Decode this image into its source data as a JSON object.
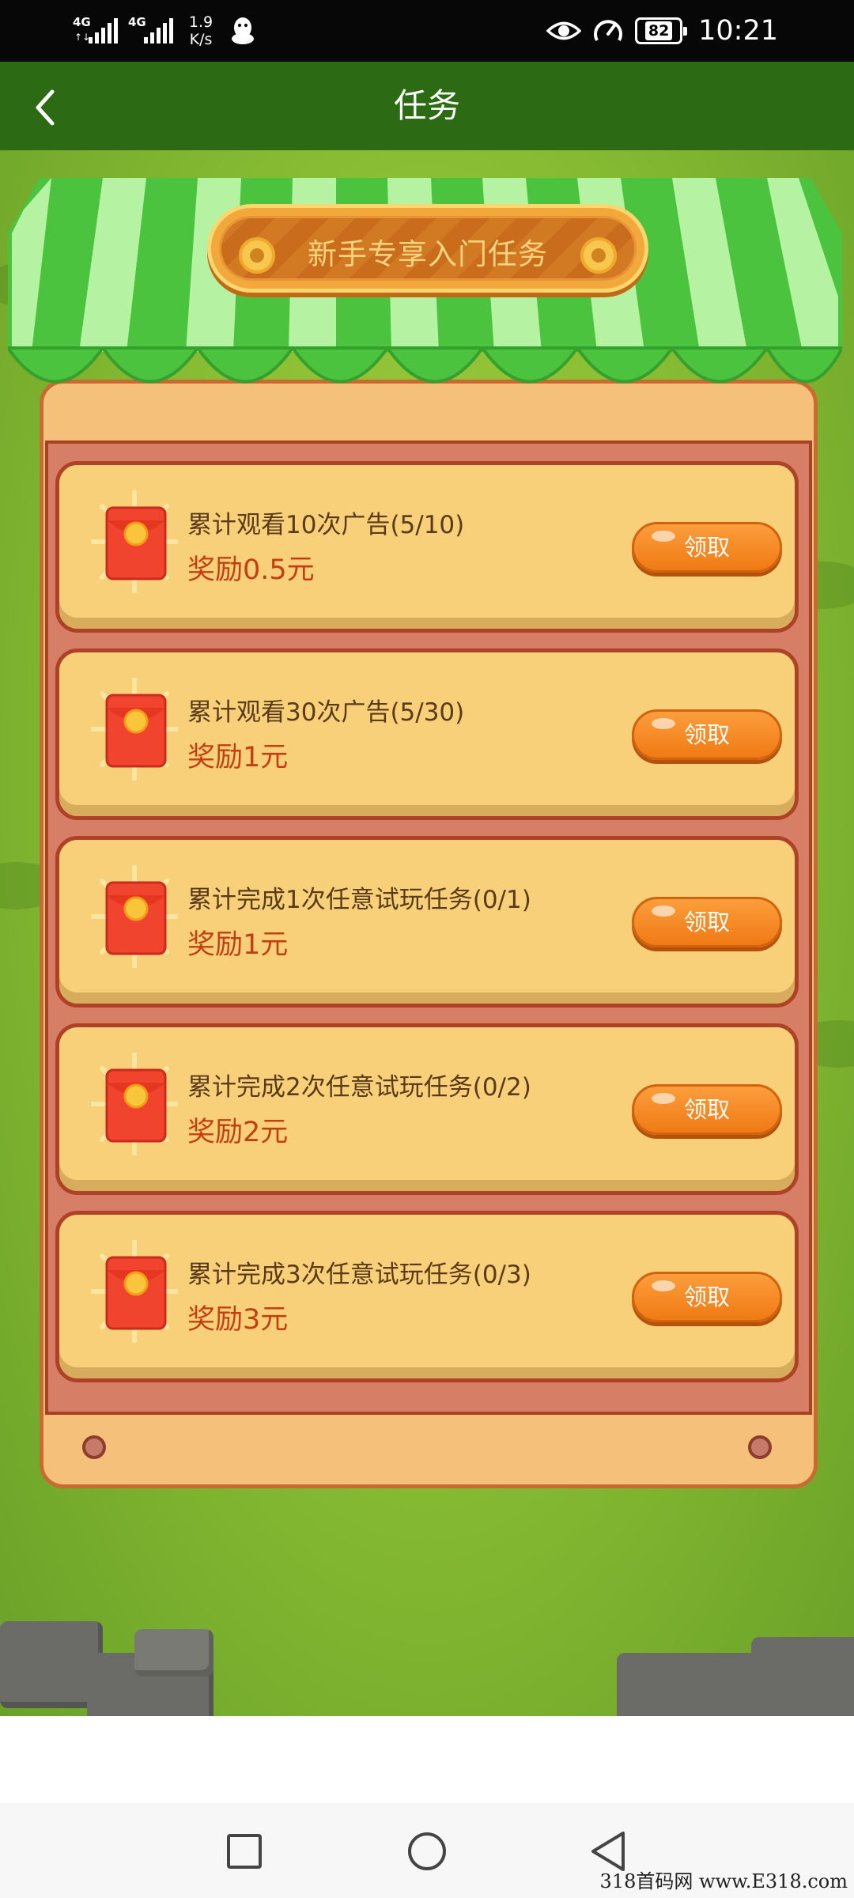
{
  "status_bar": {
    "signal1_label": "4G",
    "signal2_label": "4G",
    "net_speed_value": "1.9",
    "net_speed_unit": "K/s",
    "battery": "82",
    "time": "10:21",
    "icons": [
      "signal-icon",
      "qq-icon",
      "eye-icon",
      "speedometer-icon",
      "battery-icon"
    ]
  },
  "header": {
    "title": "任务",
    "back_icon": "chevron-left-icon"
  },
  "banner": {
    "title": "新手专享入门任务"
  },
  "tasks": [
    {
      "title": "累计观看10次广告(5/10)",
      "reward": "奖励0.5元",
      "button": "领取"
    },
    {
      "title": "累计观看30次广告(5/30)",
      "reward": "奖励1元",
      "button": "领取"
    },
    {
      "title": "累计完成1次任意试玩任务(0/1)",
      "reward": "奖励1元",
      "button": "领取"
    },
    {
      "title": "累计完成2次任意试玩任务(0/2)",
      "reward": "奖励2元",
      "button": "领取"
    },
    {
      "title": "累计完成3次任意试玩任务(0/3)",
      "reward": "奖励3元",
      "button": "领取"
    }
  ],
  "nav_bar": {
    "icons": [
      "square-recents-icon",
      "circle-home-icon",
      "triangle-back-icon"
    ]
  },
  "watermark": "318首码网 www.E318.com",
  "colors": {
    "status_bar": "#070707",
    "title_bar": "#2c6a14",
    "grass": "#8abe34",
    "card": "#f8d07a",
    "reward_text": "#c33f12",
    "button": "#f07a14"
  }
}
